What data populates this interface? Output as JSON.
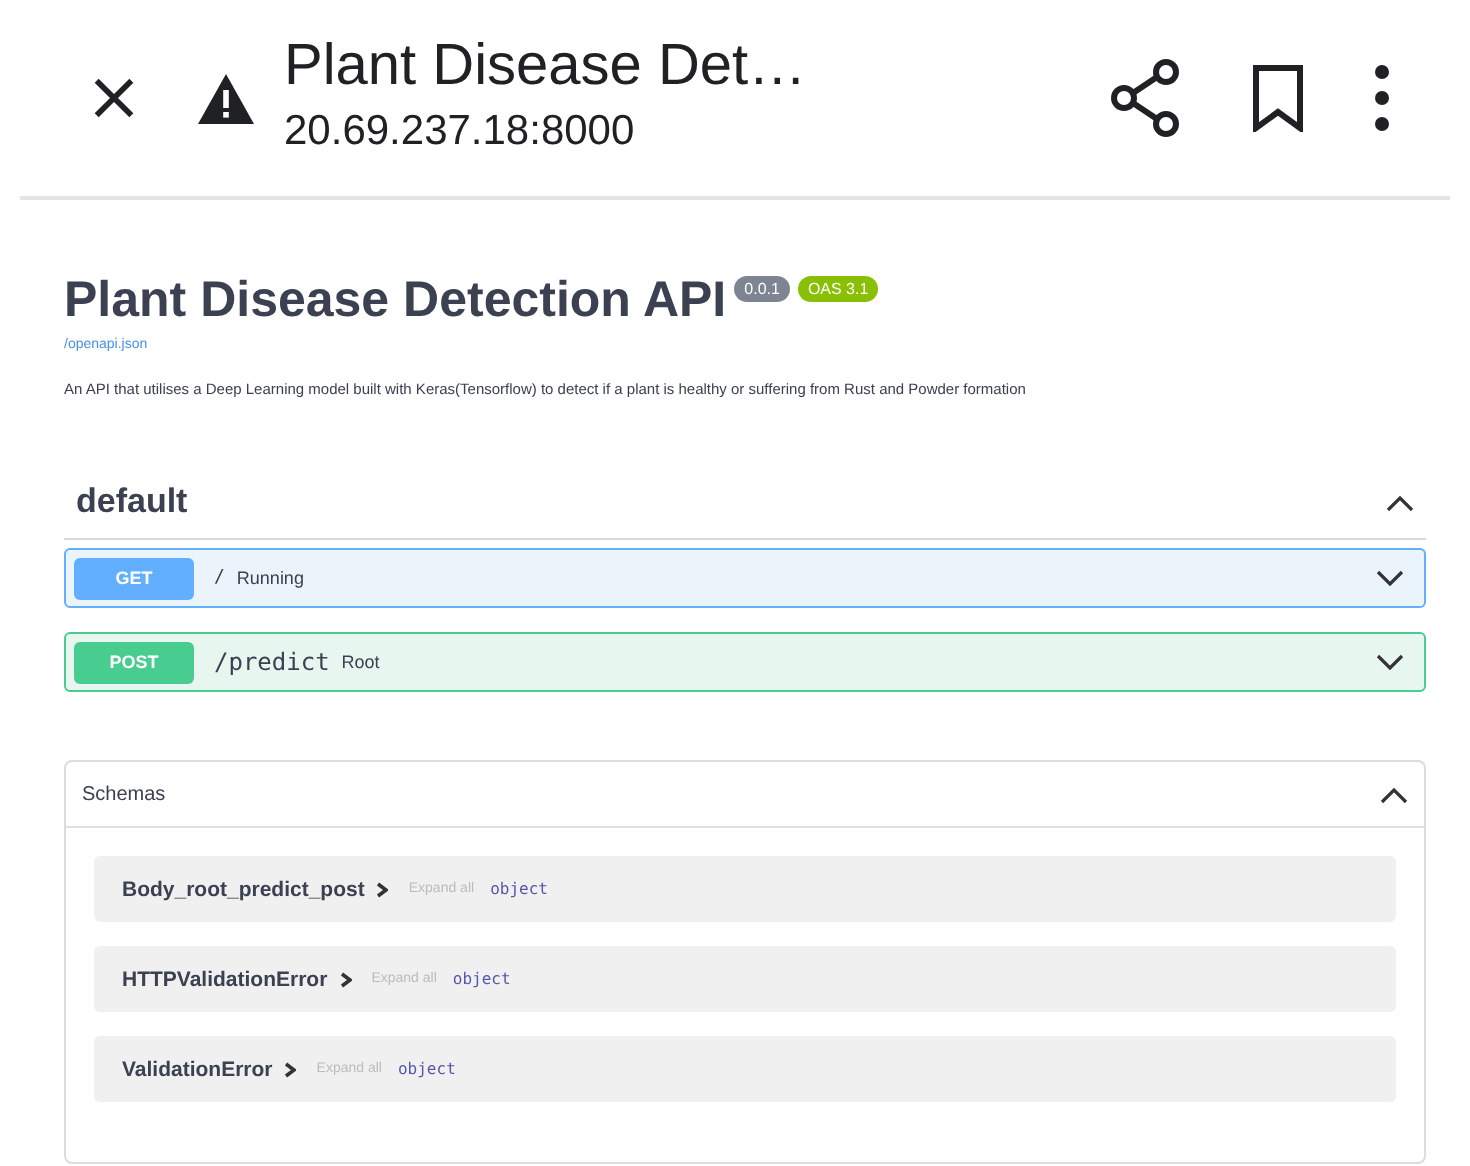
{
  "browser_bar": {
    "title": "Plant Disease Det…",
    "url": "20.69.237.18:8000",
    "insecure": true
  },
  "info": {
    "title": "Plant Disease Detection API",
    "version": "0.0.1",
    "oas": "OAS 3.1",
    "spec_link": "/openapi.json",
    "description": "An API that utilises a Deep Learning model built with Keras(Tensorflow) to detect if a plant is healthy or suffering from Rust and Powder formation"
  },
  "tag": {
    "name": "default",
    "expanded": true
  },
  "operations": [
    {
      "kind": "get",
      "method": "GET",
      "path": "/",
      "summary": "Running",
      "expanded": false
    },
    {
      "kind": "post",
      "method": "POST",
      "path": "/predict",
      "summary": "Root",
      "expanded": false
    }
  ],
  "schemas": {
    "title": "Schemas",
    "expanded": true,
    "items": [
      {
        "name": "Body_root_predict_post",
        "expand_label": "Expand all",
        "type": "object"
      },
      {
        "name": "HTTPValidationError",
        "expand_label": "Expand all",
        "type": "object"
      },
      {
        "name": "ValidationError",
        "expand_label": "Expand all",
        "type": "object"
      }
    ]
  }
}
